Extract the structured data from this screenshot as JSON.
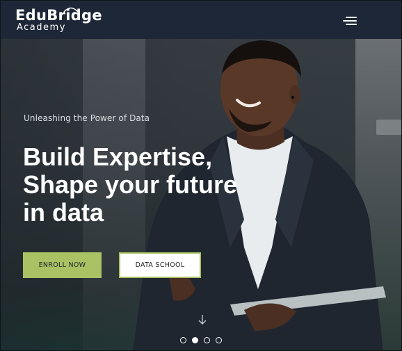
{
  "brand": {
    "name": "EduBridge",
    "subtitle": "Academy"
  },
  "header": {
    "menu_icon": "hamburger-menu-icon"
  },
  "hero": {
    "tagline": "Unleashing the Power of Data",
    "headline_lines": [
      "Build Expertise,",
      "Shape your future",
      "in data"
    ],
    "enroll_label": "ENROLL NOW",
    "school_label": "DATA SCHOOL",
    "scroll_icon": "arrow-down-icon",
    "carousel": {
      "count": 4,
      "active_index": 1
    }
  },
  "colors": {
    "header_bg": "#1d2737",
    "accent": "#a9c264",
    "text": "#ffffff"
  }
}
